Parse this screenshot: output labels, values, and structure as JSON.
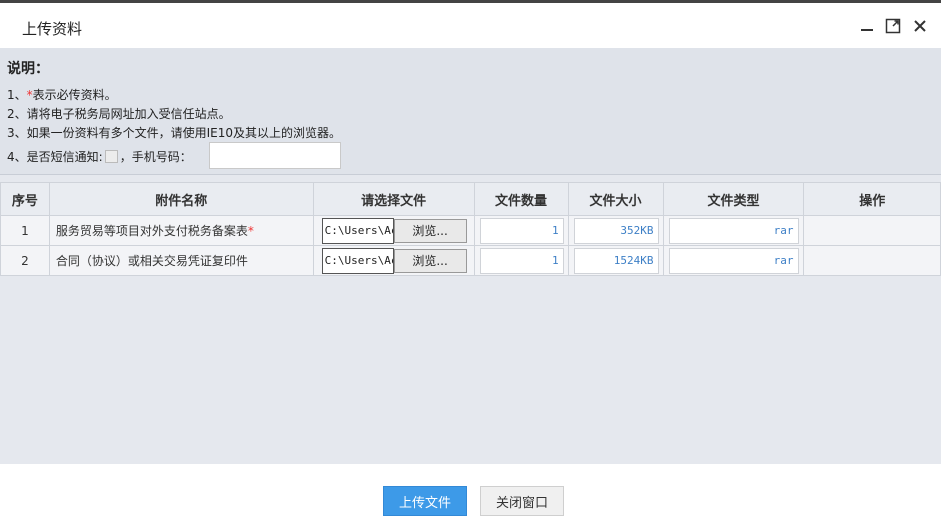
{
  "window": {
    "title": "上传资料"
  },
  "notice": {
    "heading": "说明：",
    "line1_prefix": "1、",
    "line1_star": "*",
    "line1_text": "表示必传资料。",
    "line2": "2、请将电子税务局网址加入受信任站点。",
    "line3": "3、如果一份资料有多个文件，请使用IE10及其以上的浏览器。",
    "line4_prefix": "4、是否短信通知:",
    "line4_phone_label": "，手机号码：",
    "phone_value": ""
  },
  "table": {
    "headers": [
      "序号",
      "附件名称",
      "请选择文件",
      "文件数量",
      "文件大小",
      "文件类型",
      "操作"
    ],
    "rows": [
      {
        "seq": "1",
        "name": "服务贸易等项目对外支付税务备案表",
        "required_star": "*",
        "file_path": "C:\\Users\\Ac",
        "browse": "浏览...",
        "count": "1",
        "size": "352KB",
        "type": "rar"
      },
      {
        "seq": "2",
        "name": "合同（协议）或相关交易凭证复印件",
        "required_star": "",
        "file_path": "C:\\Users\\Ac",
        "browse": "浏览...",
        "count": "1",
        "size": "1524KB",
        "type": "rar"
      }
    ]
  },
  "footer": {
    "upload_label": "上传文件",
    "close_label": "关闭窗口"
  }
}
